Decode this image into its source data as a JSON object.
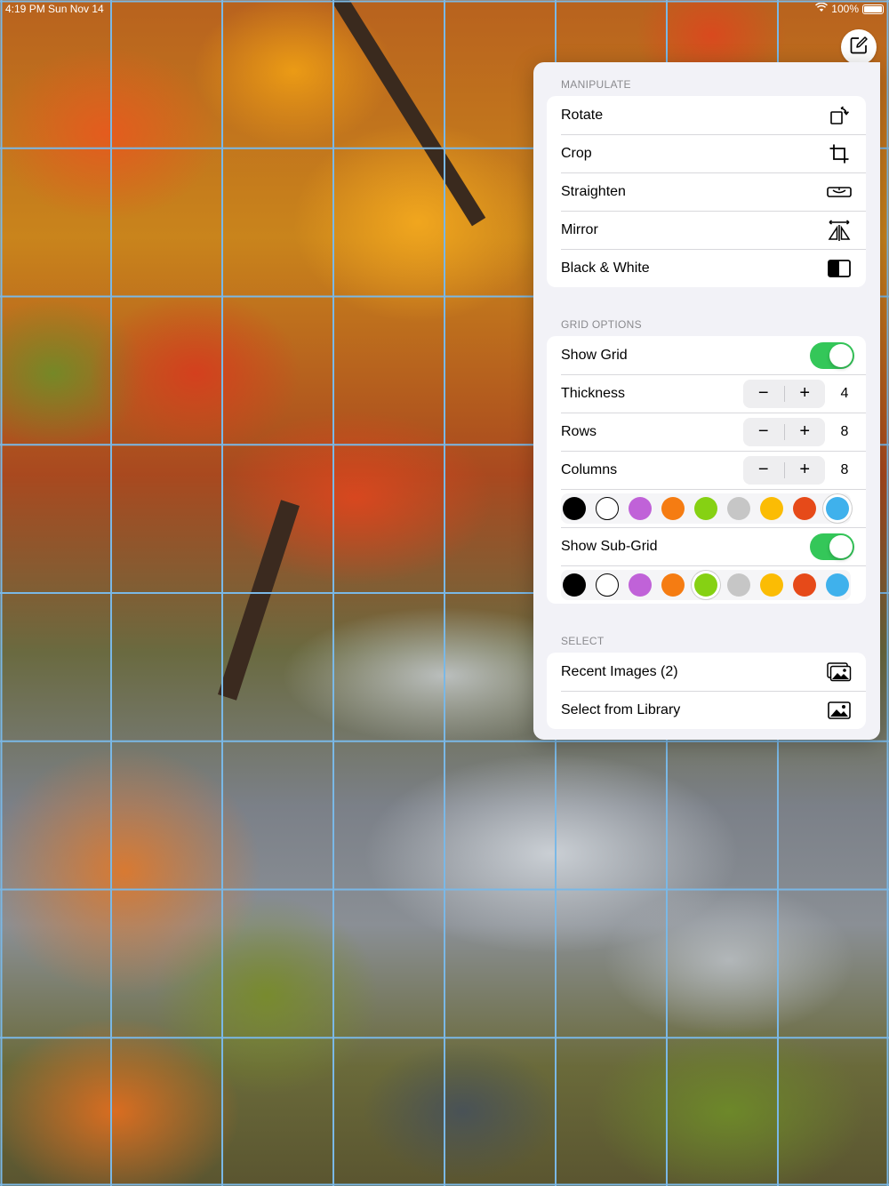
{
  "status_bar": {
    "time": "4:19 PM   Sun Nov 14",
    "battery": "100%"
  },
  "edit_button": {
    "icon": "edit-square-icon"
  },
  "grid": {
    "rows": 8,
    "columns": 8,
    "color": "#7ab8e6",
    "sub_grid_color": "#7ab8e6"
  },
  "popover": {
    "manipulate": {
      "header": "MANIPULATE",
      "items": [
        {
          "label": "Rotate",
          "icon": "rotate-icon"
        },
        {
          "label": "Crop",
          "icon": "crop-icon"
        },
        {
          "label": "Straighten",
          "icon": "straighten-icon"
        },
        {
          "label": "Mirror",
          "icon": "mirror-icon"
        },
        {
          "label": "Black & White",
          "icon": "black-white-icon"
        }
      ]
    },
    "grid_options": {
      "header": "GRID OPTIONS",
      "show_grid": {
        "label": "Show Grid",
        "on": true
      },
      "thickness": {
        "label": "Thickness",
        "value": "4"
      },
      "rows": {
        "label": "Rows",
        "value": "8"
      },
      "columns": {
        "label": "Columns",
        "value": "8"
      },
      "grid_colors": [
        "#000000",
        "#ffffff",
        "#c062d8",
        "#f57c12",
        "#86d113",
        "#c6c6c6",
        "#fbbc04",
        "#e64a19",
        "#3fb1ec"
      ],
      "grid_selected_color": "#3fb1ec",
      "show_sub_grid": {
        "label": "Show Sub-Grid",
        "on": true
      },
      "sub_grid_colors": [
        "#000000",
        "#ffffff",
        "#c062d8",
        "#f57c12",
        "#86d113",
        "#c6c6c6",
        "#fbbc04",
        "#e64a19",
        "#3fb1ec"
      ],
      "sub_grid_selected_color": "#86d113",
      "minus": "−",
      "plus": "+"
    },
    "select": {
      "header": "SELECT",
      "items": [
        {
          "label": "Recent Images (2)",
          "icon": "recent-images-icon"
        },
        {
          "label": "Select from Library",
          "icon": "photo-library-icon"
        }
      ]
    }
  }
}
